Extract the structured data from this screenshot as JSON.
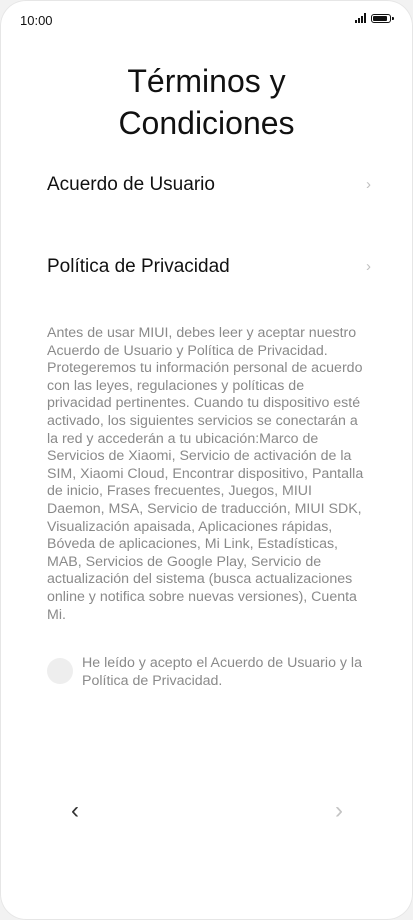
{
  "status_bar": {
    "time": "10:00",
    "icons": [
      "signal-icon",
      "battery-icon"
    ]
  },
  "title": {
    "line1": "Términos y",
    "line2": "Condiciones"
  },
  "menu": {
    "items": [
      {
        "label": "Acuerdo de Usuario",
        "icon": "chevron-right-icon"
      },
      {
        "label": "Política de Privacidad",
        "icon": "chevron-right-icon"
      }
    ]
  },
  "info_text": "Antes de usar MIUI, debes leer y aceptar nuestro Acuerdo de Usuario y Política de Privacidad. Protegeremos tu información personal de acuerdo con las leyes, regulaciones y políticas de privacidad pertinentes. Cuando tu dispositivo esté activado, los siguientes servicios se conectarán a la red y accederán a tu ubicación:Marco de Servicios de Xiaomi, Servicio de activación de la SIM, Xiaomi Cloud, Encontrar dispositivo, Pantalla de inicio, Frases frecuentes, Juegos, MIUI Daemon, MSA, Servicio de traducción, MIUI SDK, Visualización apaisada, Aplicaciones rápidas, Bóveda de aplicaciones, Mi Link, Estadísticas, MAB, Servicios de Google Play, Servicio de actualización del sistema (busca actualizaciones online y notifica sobre nuevas versiones), Cuenta Mi.",
  "agree": {
    "label": "He leído y acepto el Acuerdo de Usuario y la Política de Privacidad.",
    "checked": false
  },
  "nav": {
    "back_icon": "chevron-left-icon",
    "next_icon": "chevron-right-icon",
    "back_glyph": "‹",
    "next_glyph": "›"
  },
  "colors": {
    "text_primary": "#111111",
    "text_secondary": "#8a8a8a",
    "chevron": "#c0c0c0",
    "checkbox_bg": "#eeeeee"
  }
}
